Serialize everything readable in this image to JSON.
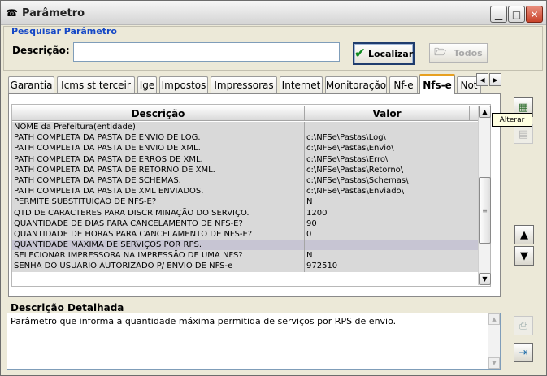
{
  "window": {
    "title": "Parâmetro",
    "icon": "phone-icon",
    "minimize": "▁",
    "maximize": "□",
    "close": "✕"
  },
  "search": {
    "group_title": "Pesquisar Parâmetro",
    "description_label": "Descrição:",
    "description_value": "",
    "localizar_label": "ocalizar",
    "localizar_mnemonic": "L",
    "todos_label": "Todos"
  },
  "tabs": [
    {
      "label": "Garantia",
      "active": false
    },
    {
      "label": "Icms st terceir",
      "active": false
    },
    {
      "label": "Ige",
      "active": false
    },
    {
      "label": "Impostos",
      "active": false
    },
    {
      "label": "Impressoras",
      "active": false
    },
    {
      "label": "Internet",
      "active": false
    },
    {
      "label": "Monitoração",
      "active": false
    },
    {
      "label": "Nf-e",
      "active": false
    },
    {
      "label": "Nfs-e",
      "active": true
    },
    {
      "label": "Not",
      "active": false
    }
  ],
  "grid": {
    "columns": [
      "Descrição",
      "Valor"
    ],
    "selected_row": 12,
    "rows": [
      {
        "descricao": "NOME da Prefeitura(entidade)",
        "valor": ""
      },
      {
        "descricao": "PATH COMPLETA DA PASTA DE ENVIO DE LOG.",
        "valor": "c:\\NFSe\\Pastas\\Log\\"
      },
      {
        "descricao": "PATH COMPLETA DA PASTA DE ENVIO DE XML.",
        "valor": "c:\\NFSe\\Pastas\\Envio\\"
      },
      {
        "descricao": "PATH COMPLETA DA PASTA DE ERROS DE XML.",
        "valor": "c:\\NFSe\\Pastas\\Erro\\"
      },
      {
        "descricao": "PATH COMPLETA DA PASTA DE RETORNO DE XML.",
        "valor": "c:\\NFSe\\Pastas\\Retorno\\"
      },
      {
        "descricao": "PATH COMPLETA DA PASTA DE SCHEMAS.",
        "valor": "c:\\NFSe\\Pastas\\Schemas\\"
      },
      {
        "descricao": "PATH COMPLETA DA PASTA DE XML ENVIADOS.",
        "valor": "c:\\NFSe\\Pastas\\Enviado\\"
      },
      {
        "descricao": "PERMITE SUBSTITUIÇÃO DE NFS-E?",
        "valor": "N"
      },
      {
        "descricao": "QTD DE CARACTERES PARA DISCRIMINAÇÃO DO SERVIÇO.",
        "valor": "1200"
      },
      {
        "descricao": "QUANTIDADE DE DIAS PARA CANCELAMENTO DE NFS-E?",
        "valor": "90"
      },
      {
        "descricao": "QUANTIDADE DE HORAS PARA CANCELAMENTO DE NFS-E?",
        "valor": "0"
      },
      {
        "descricao": "QUANTIDADE MÁXIMA DE SERVIÇOS POR RPS.",
        "valor": ""
      },
      {
        "descricao": "SELECIONAR IMPRESSORA NA IMPRESSÃO DE UMA NFS?",
        "valor": "N"
      },
      {
        "descricao": "SENHA DO USUARIO AUTORIZADO P/ ENVIO DE NFS-e",
        "valor": "972510"
      }
    ]
  },
  "side": {
    "alterar_tooltip": "Alterar",
    "move_up": "▲",
    "move_down": "▼"
  },
  "detail": {
    "label": "Descrição Detalhada",
    "text": "Parâmetro que informa a quantidade máxima permitida de serviços por RPS de envio."
  }
}
